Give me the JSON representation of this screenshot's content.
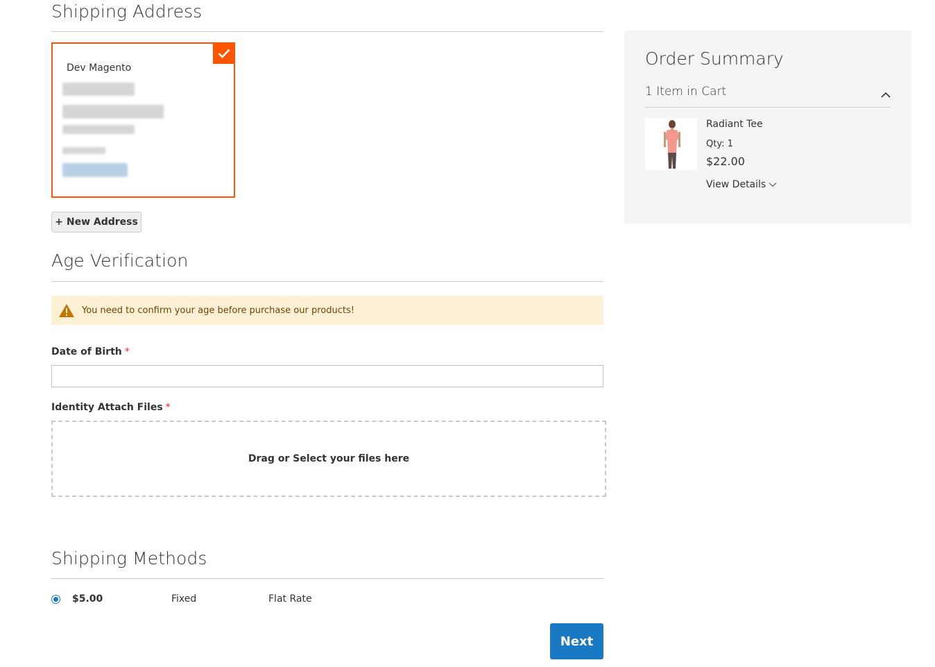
{
  "shipping_address": {
    "title": "Shipping Address",
    "selected_address": {
      "name": "Dev Magento"
    },
    "new_address_button": {
      "icon": "+",
      "label": "New Address"
    }
  },
  "age_verification": {
    "title": "Age Verification",
    "warning": "You need to confirm your age before purchase our products!",
    "dob_label": "Date of Birth",
    "dob_value": "",
    "required_marker": "*",
    "files_label": "Identity Attach Files",
    "dropzone_text": "Drag or Select your files here"
  },
  "shipping_methods": {
    "title": "Shipping Methods",
    "options": [
      {
        "price": "$5.00",
        "method": "Fixed",
        "carrier": "Flat Rate",
        "selected": true
      }
    ]
  },
  "next_button": "Next",
  "order_summary": {
    "title": "Order Summary",
    "cart_count": "1 Item in Cart",
    "items": [
      {
        "name": "Radiant Tee",
        "qty": "Qty: 1",
        "price": "$22.00",
        "details_link": "View Details"
      }
    ]
  },
  "colors": {
    "accent_orange": "#ff5501",
    "primary_blue": "#1979c3",
    "warning_bg": "#fdf0d5",
    "summary_bg": "#f5f5f5"
  }
}
